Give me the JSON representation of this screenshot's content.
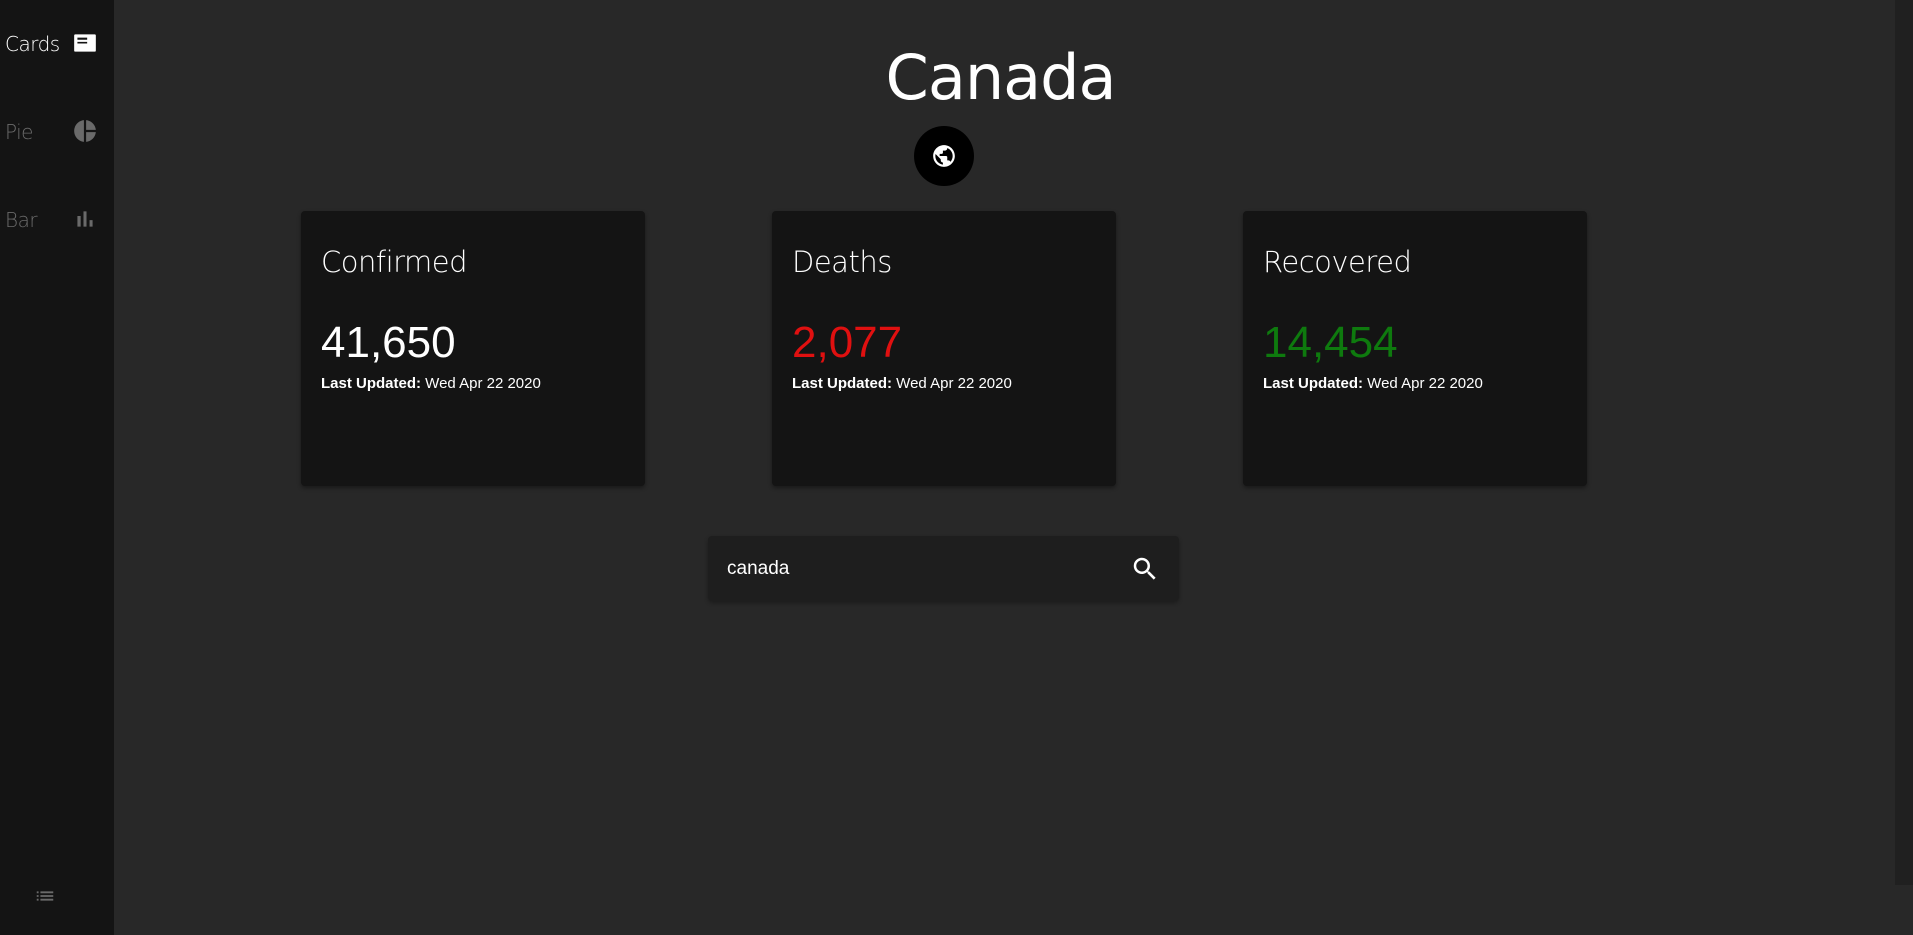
{
  "sidebar": {
    "items": [
      {
        "label": "Cards",
        "icon": "card-icon",
        "active": true
      },
      {
        "label": "Pie",
        "icon": "pie-chart-icon",
        "active": false
      },
      {
        "label": "Bar",
        "icon": "bar-chart-icon",
        "active": false
      }
    ],
    "bottom_icon": "list-icon"
  },
  "header": {
    "title": "Canada",
    "globe_icon": "globe-icon"
  },
  "cards": [
    {
      "title": "Confirmed",
      "value": "41,650",
      "updated_label": "Last Updated:",
      "updated_value": " Wed Apr 22 2020",
      "color": "#ffffff"
    },
    {
      "title": "Deaths",
      "value": "2,077",
      "updated_label": "Last Updated:",
      "updated_value": " Wed Apr 22 2020",
      "color": "#e01010"
    },
    {
      "title": "Recovered",
      "value": "14,454",
      "updated_label": "Last Updated:",
      "updated_value": " Wed Apr 22 2020",
      "color": "#0e7a0e"
    }
  ],
  "search": {
    "value": "canada",
    "icon": "search-icon"
  },
  "colors": {
    "background": "#282828",
    "sidebar": "#141414",
    "card": "#141414",
    "deaths": "#e01010",
    "recovered": "#0e7a0e"
  }
}
